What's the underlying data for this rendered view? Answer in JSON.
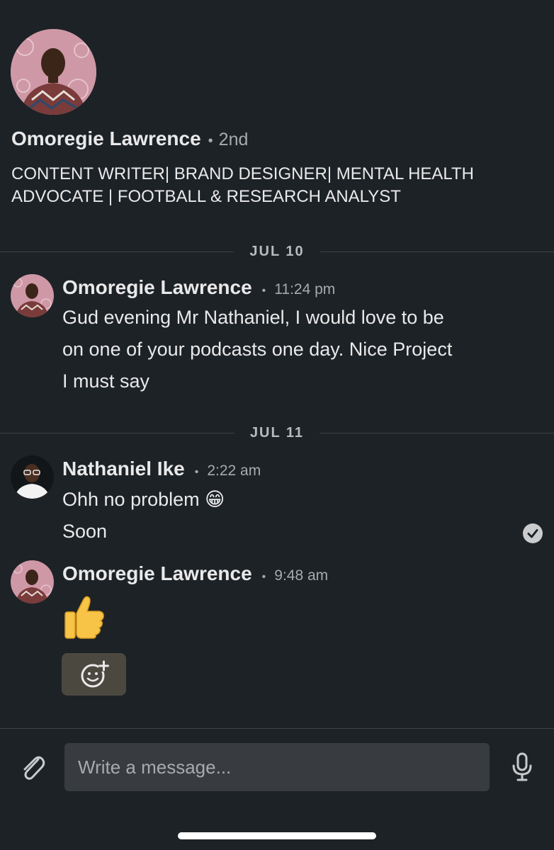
{
  "profile": {
    "name": "Omoregie Lawrence",
    "separator": "•",
    "degree": "2nd",
    "headline": "CONTENT WRITER| BRAND DESIGNER| MENTAL HEALTH ADVOCATE | FOOTBALL & RESEARCH ANALYST"
  },
  "dates": [
    "JUL 10",
    "JUL 11"
  ],
  "messages": [
    {
      "sender": "Omoregie Lawrence",
      "separator": "•",
      "time": "11:24 pm",
      "lines": [
        "Gud evening Mr Nathaniel, I would love to be",
        "on one of your podcasts one day. Nice Project",
        "I must say"
      ]
    },
    {
      "sender": "Nathaniel Ike",
      "separator": "•",
      "time": "2:22 am",
      "lines": [
        "Ohh no problem 😁",
        "Soon"
      ],
      "status_icon": "read-check-icon"
    },
    {
      "sender": "Omoregie Lawrence",
      "separator": "•",
      "time": "9:48 am",
      "emoji_icon": "thumbs-up-icon",
      "reaction_button_icon": "add-reaction-icon"
    }
  ],
  "composer": {
    "placeholder": "Write a message...",
    "attach_icon": "paperclip-icon",
    "mic_icon": "microphone-icon"
  },
  "colors": {
    "background": "#1d2226",
    "text": "#e9e9ea",
    "muted": "#a8aaac",
    "divider": "#3d4246",
    "input_bg": "#383c40",
    "reaction_bg": "#4b4840"
  }
}
